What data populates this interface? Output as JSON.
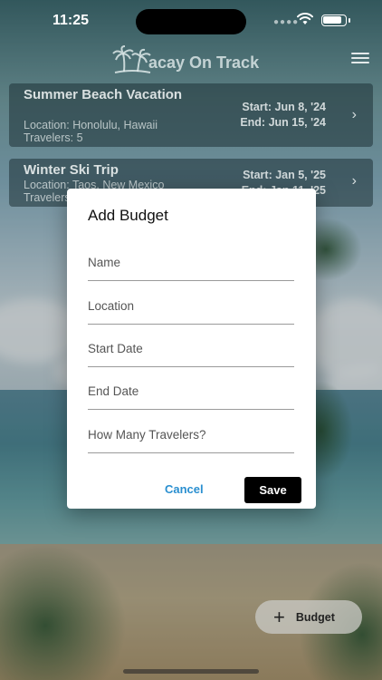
{
  "status_bar": {
    "time": "11:25"
  },
  "header": {
    "app_title": "acay On Track",
    "logo_icon": "palm-trees-icon",
    "menu_icon": "hamburger-menu-icon"
  },
  "trips": [
    {
      "title": "Summer Beach Vacation",
      "location": "Location: Honolulu, Hawaii",
      "travelers": "Travelers: 5",
      "start": "Start: Jun 8, '24",
      "end": "End: Jun 15, '24"
    },
    {
      "title": "Winter Ski Trip",
      "location": "Location: Taos, New Mexico",
      "travelers": "Travelers",
      "start": "Start: Jan 5, '25",
      "end": "End: Jan 11, '25"
    }
  ],
  "dialog": {
    "title": "Add Budget",
    "fields": [
      "Name",
      "Location",
      "Start Date",
      "End Date",
      "How Many Travelers?"
    ],
    "cancel_label": "Cancel",
    "save_label": "Save"
  },
  "fab": {
    "label": "Budget",
    "icon": "plus-icon"
  },
  "colors": {
    "accent": "#2a8fd0",
    "primary_button": "#000000"
  }
}
